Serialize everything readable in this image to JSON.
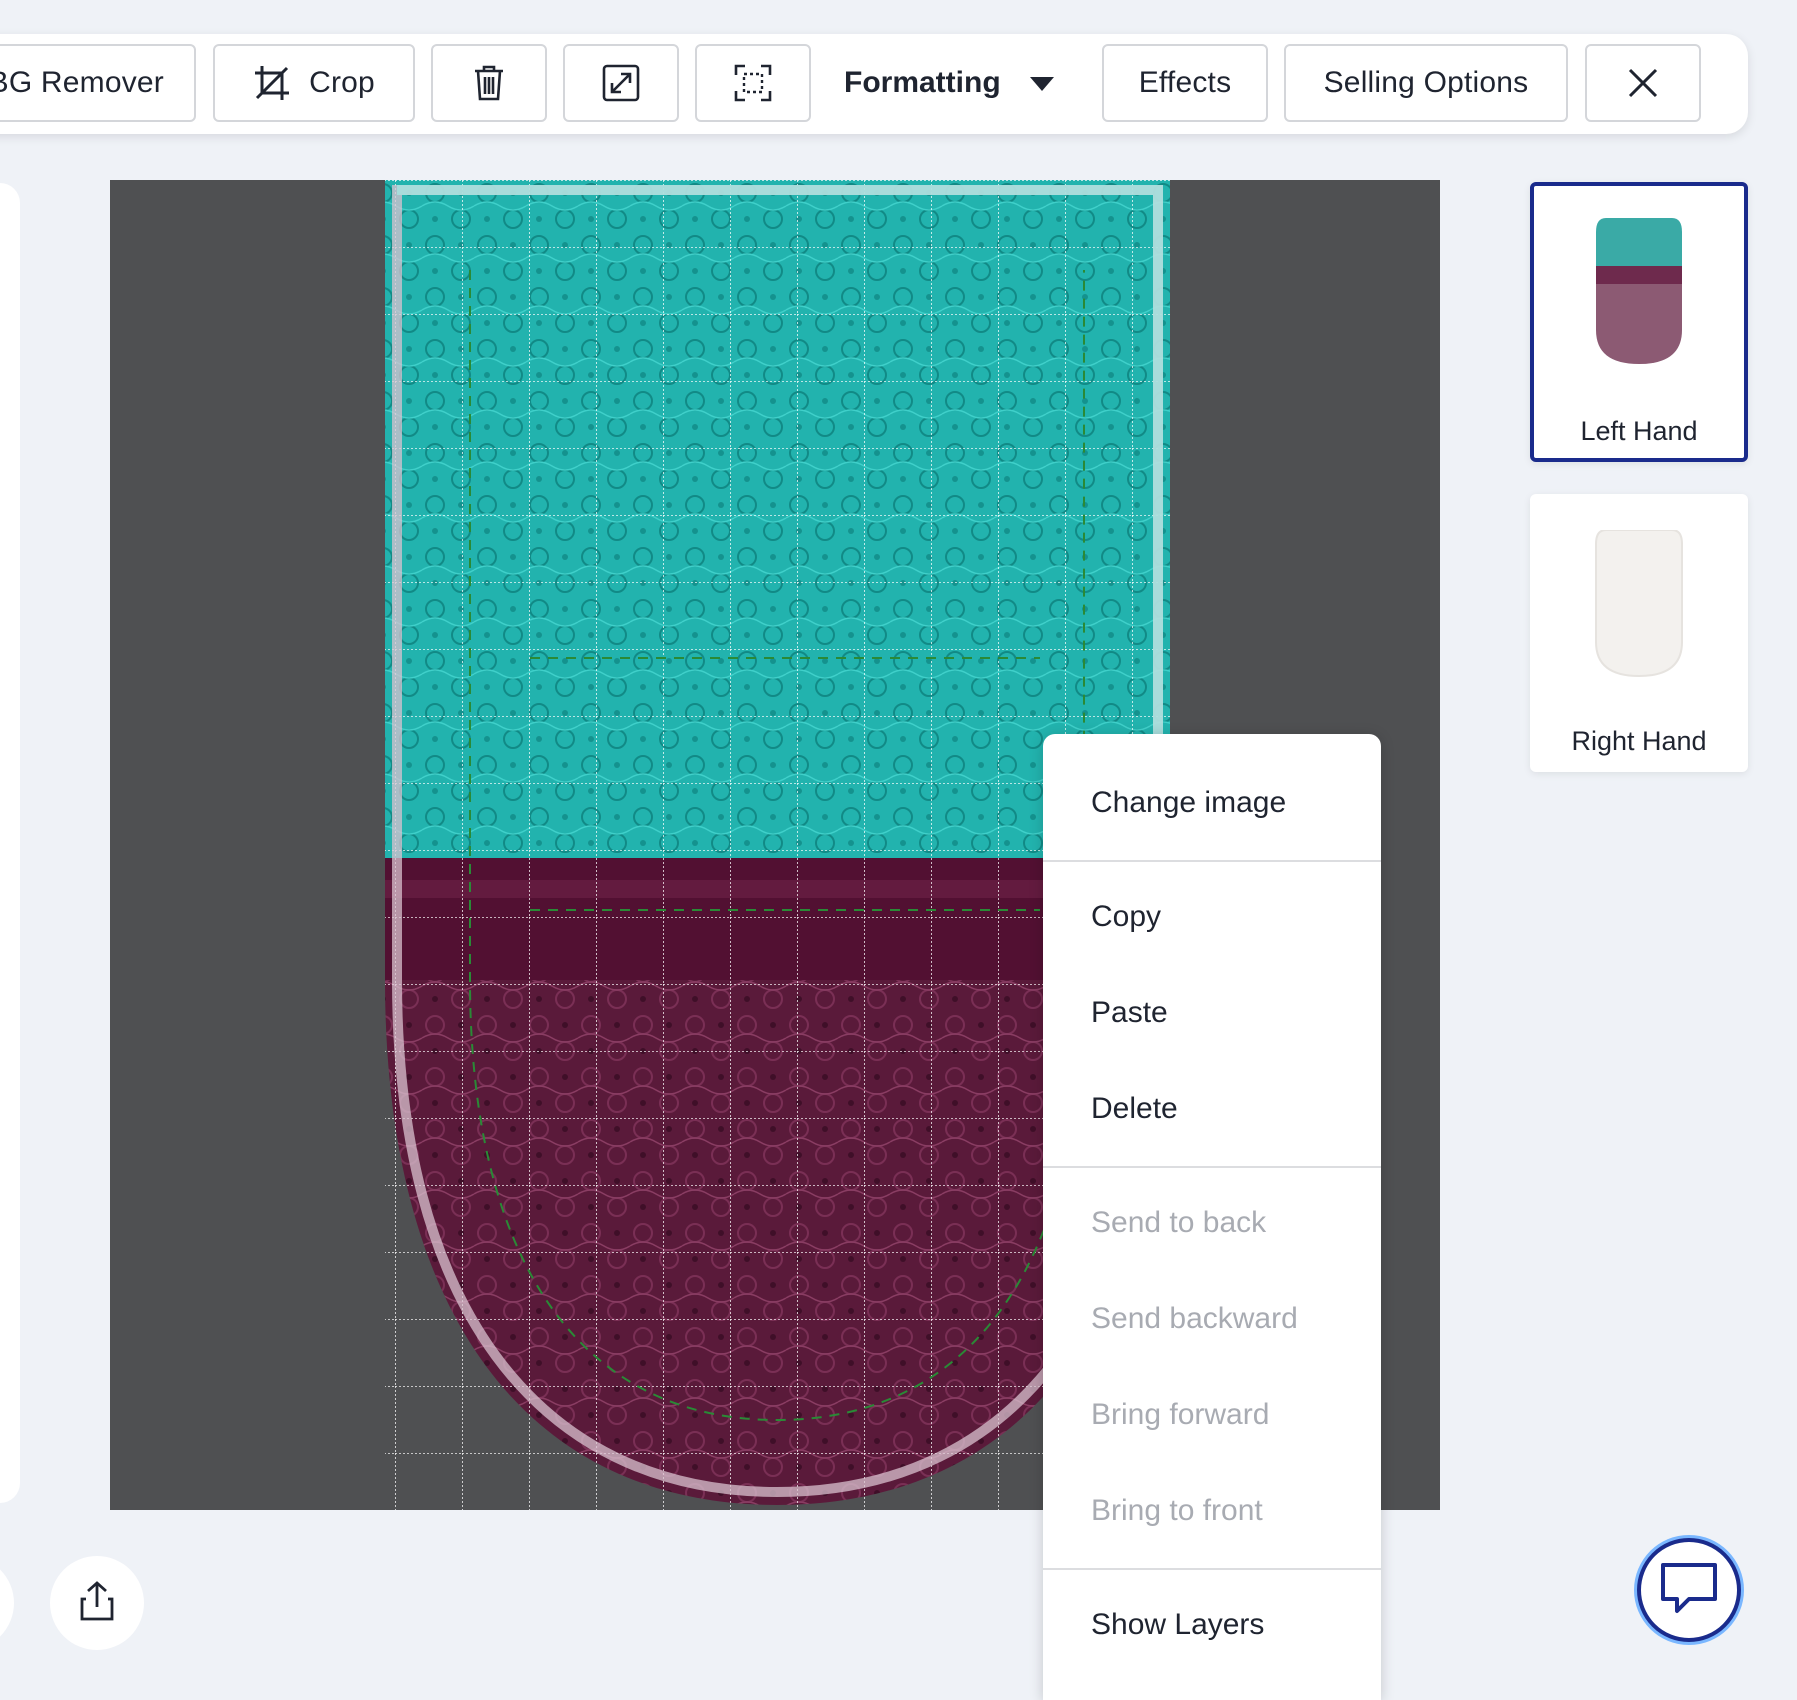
{
  "toolbar": {
    "bg_remover_label": "BG Remover",
    "crop_label": "Crop",
    "delete_icon": "trash-icon",
    "resize_icon": "expand-icon",
    "fit_icon": "fit-frame-icon",
    "formatting_label": "Formatting",
    "effects_label": "Effects",
    "selling_options_label": "Selling Options",
    "close_icon": "close-icon"
  },
  "context_menu": {
    "change_image": "Change image",
    "copy": "Copy",
    "paste": "Paste",
    "delete": "Delete",
    "send_to_back": "Send to back",
    "send_backward": "Send backward",
    "bring_forward": "Bring forward",
    "bring_to_front": "Bring to front",
    "show_layers": "Show Layers"
  },
  "hands": [
    {
      "label": "Left Hand",
      "selected": true
    },
    {
      "label": "Right Hand",
      "selected": false
    }
  ],
  "colors": {
    "teal_lace": "#20b5b1",
    "maroon_lace": "#5c1a3c",
    "canvas_bg": "#4f5052",
    "accent": "#1a2b8c"
  }
}
